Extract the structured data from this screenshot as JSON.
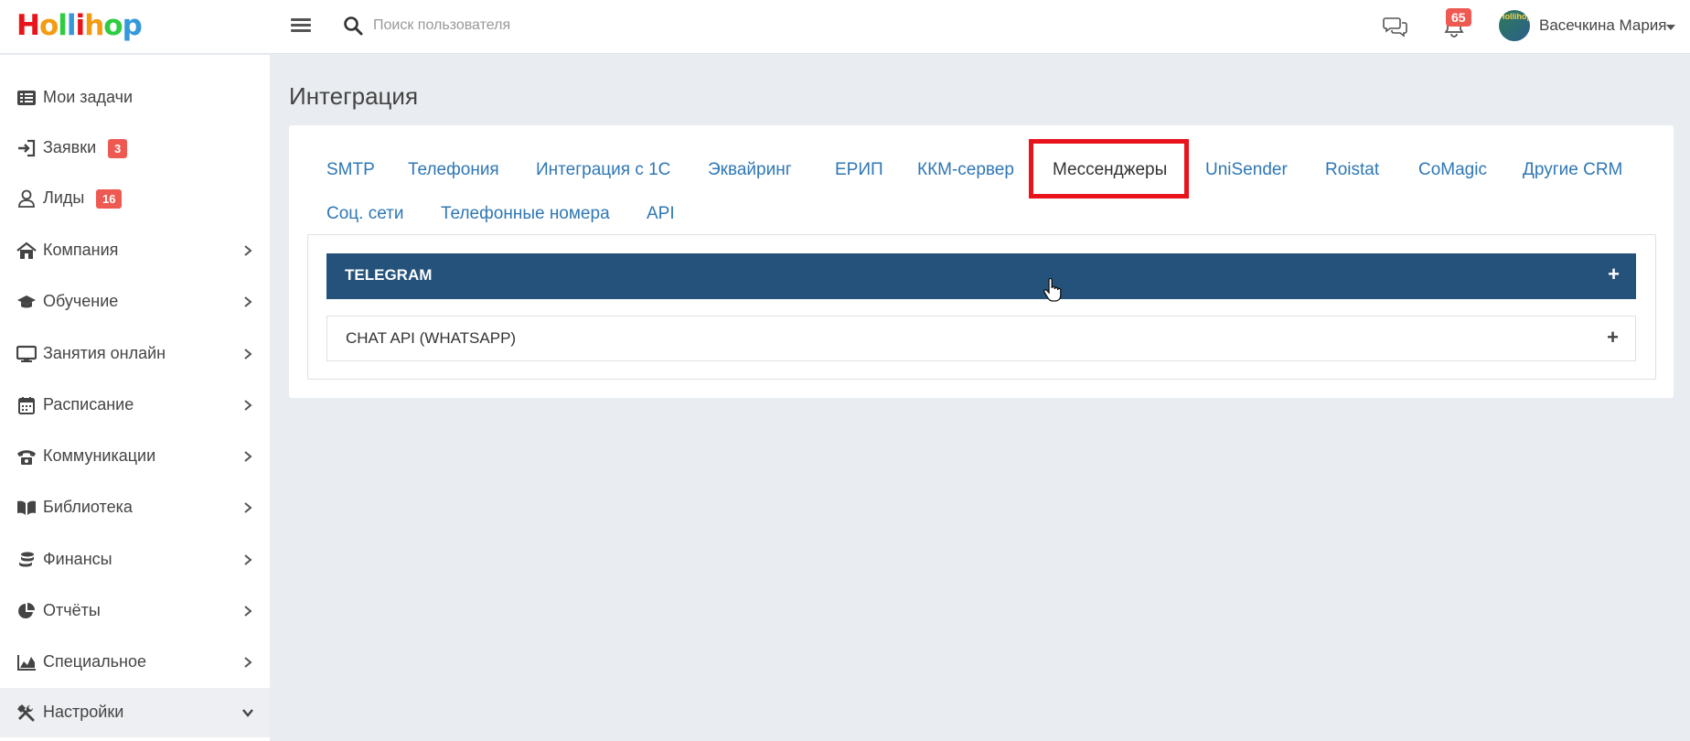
{
  "header": {
    "logo_letters": [
      {
        "ch": "H",
        "color": "#e8131b"
      },
      {
        "ch": "o",
        "color": "#f39c12"
      },
      {
        "ch": "l",
        "color": "#2ecc40"
      },
      {
        "ch": "l",
        "color": "#3498db"
      },
      {
        "ch": "i",
        "color": "#e8131b"
      },
      {
        "ch": "h",
        "color": "#f39c12"
      },
      {
        "ch": "o",
        "color": "#2ecc40"
      },
      {
        "ch": "p",
        "color": "#3498db"
      }
    ],
    "search_placeholder": "Поиск пользователя",
    "notifications_count": "65",
    "avatar_text": "Hollihop",
    "user_name": "Васечкина Мария"
  },
  "sidebar": {
    "items": [
      {
        "label": "Мои задачи",
        "icon": "list-icon",
        "badge": null,
        "chevron": false
      },
      {
        "label": "Заявки",
        "icon": "sign-in-icon",
        "badge": "3",
        "chevron": false
      },
      {
        "label": "Лиды",
        "icon": "user-icon",
        "badge": "16",
        "chevron": false
      },
      {
        "label": "Компания",
        "icon": "home-icon",
        "badge": null,
        "chevron": true
      },
      {
        "label": "Обучение",
        "icon": "graduation-cap-icon",
        "badge": null,
        "chevron": true
      },
      {
        "label": "Занятия онлайн",
        "icon": "monitor-icon",
        "badge": null,
        "chevron": true
      },
      {
        "label": "Расписание",
        "icon": "calendar-icon",
        "badge": null,
        "chevron": true
      },
      {
        "label": "Коммуникации",
        "icon": "phone-icon",
        "badge": null,
        "chevron": true
      },
      {
        "label": "Библиотека",
        "icon": "book-icon",
        "badge": null,
        "chevron": true
      },
      {
        "label": "Финансы",
        "icon": "coins-icon",
        "badge": null,
        "chevron": true
      },
      {
        "label": "Отчёты",
        "icon": "pie-chart-icon",
        "badge": null,
        "chevron": true
      },
      {
        "label": "Специальное",
        "icon": "area-chart-icon",
        "badge": null,
        "chevron": true
      },
      {
        "label": "Настройки",
        "icon": "tools-icon",
        "badge": null,
        "chevron": true,
        "active": true
      }
    ]
  },
  "main": {
    "title": "Интеграция",
    "tabs": [
      {
        "label": "SMTP"
      },
      {
        "label": "Телефония"
      },
      {
        "label": "Интеграция с 1С"
      },
      {
        "label": "Эквайринг"
      },
      {
        "label": "ЕРИП"
      },
      {
        "label": "ККМ-сервер"
      },
      {
        "label": "Мессенджеры",
        "active": true
      },
      {
        "label": "UniSender"
      },
      {
        "label": "Roistat"
      },
      {
        "label": "CoMagic"
      },
      {
        "label": "Другие CRM"
      },
      {
        "label": "Соц. сети"
      },
      {
        "label": "Телефонные номера"
      },
      {
        "label": "API"
      }
    ],
    "accordions": [
      {
        "title": "TELEGRAM",
        "toggle": "+"
      },
      {
        "title": "CHAT API (WHATSAPP)",
        "toggle": "+"
      }
    ]
  },
  "colors": {
    "accent_link": "#2f77b5",
    "accordion_active": "#24527a",
    "badge": "#ee5a52",
    "highlight": "#e8131b"
  }
}
